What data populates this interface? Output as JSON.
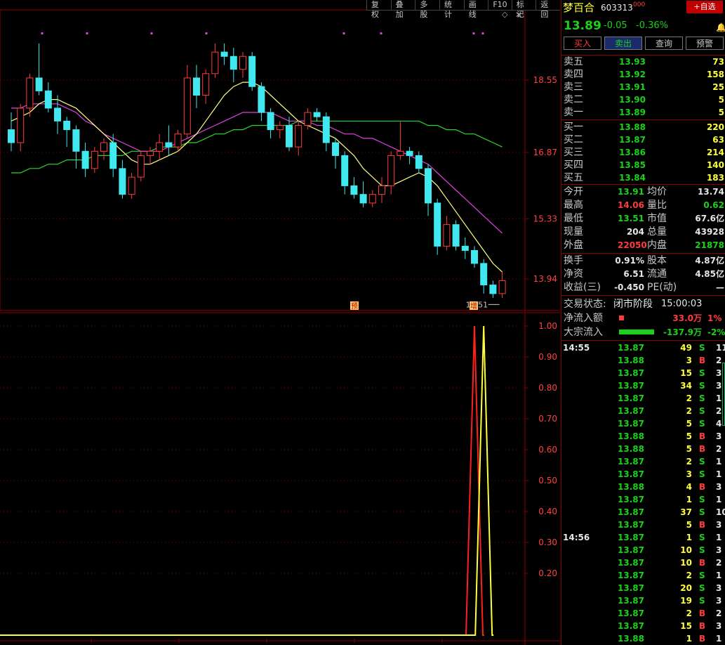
{
  "toolbar": [
    "复权",
    "叠加",
    "多股",
    "统计",
    "画线",
    "F10",
    "标记",
    "返回"
  ],
  "upper_axis": [
    "18.55",
    "16.87",
    "15.33",
    "13.94"
  ],
  "lower_axis": [
    "1.00",
    "0.90",
    "0.80",
    "0.70",
    "0.60",
    "0.50",
    "0.40",
    "0.30",
    "0.20"
  ],
  "annotations": {
    "low_label": "13.51",
    "marker_pre": "预",
    "marker_add": "增"
  },
  "stock": {
    "name": "梦百合",
    "code": "603313",
    "badge": "000",
    "add_btn": "+自选",
    "price": "13.89",
    "change": "-0.05",
    "pct": "-0.36%"
  },
  "trade_buttons": [
    "买入",
    "卖出",
    "查询",
    "预警"
  ],
  "sell_orders": [
    {
      "label": "卖五",
      "price": "13.93",
      "vol": "73"
    },
    {
      "label": "卖四",
      "price": "13.92",
      "vol": "158"
    },
    {
      "label": "卖三",
      "price": "13.91",
      "vol": "25"
    },
    {
      "label": "卖二",
      "price": "13.90",
      "vol": "5"
    },
    {
      "label": "卖一",
      "price": "13.89",
      "vol": "5"
    }
  ],
  "buy_orders": [
    {
      "label": "买一",
      "price": "13.88",
      "vol": "220"
    },
    {
      "label": "买二",
      "price": "13.87",
      "vol": "63"
    },
    {
      "label": "买三",
      "price": "13.86",
      "vol": "214"
    },
    {
      "label": "买四",
      "price": "13.85",
      "vol": "140"
    },
    {
      "label": "买五",
      "price": "13.84",
      "vol": "183"
    }
  ],
  "stats": [
    {
      "l1": "今开",
      "v1": "13.91",
      "l2": "均价",
      "v2": "13.74",
      "c": "g"
    },
    {
      "l1": "最高",
      "v1": "14.06",
      "l2": "量比",
      "v2": "0.62",
      "c": "r"
    },
    {
      "l1": "最低",
      "v1": "13.51",
      "l2": "市值",
      "v2": "67.6亿",
      "c": "g"
    },
    {
      "l1": "现量",
      "v1": "204",
      "l2": "总量",
      "v2": "43928",
      "c": "w"
    },
    {
      "l1": "外盘",
      "v1": "22050",
      "l2": "内盘",
      "v2": "21878",
      "c": "r"
    }
  ],
  "stats2": [
    {
      "l1": "换手",
      "v1": "0.91%",
      "l2": "股本",
      "v2": "4.87亿"
    },
    {
      "l1": "净资",
      "v1": "6.51",
      "l2": "流通",
      "v2": "4.85亿"
    },
    {
      "l1": "收益(三)",
      "v1": "-0.450",
      "l2": "PE(动)",
      "v2": "—"
    }
  ],
  "status": {
    "label": "交易状态:",
    "state": "闭市阶段",
    "time": "15:00:03"
  },
  "flows": [
    {
      "label": "净流入额",
      "value": "33.0万",
      "pct": "1%",
      "bar": "#ff3c3c",
      "barw": 7
    },
    {
      "label": "大宗流入",
      "value": "-137.9万",
      "pct": "-2%",
      "bar": "#19d219",
      "barw": 50
    }
  ],
  "ticks": [
    {
      "time": "14:55",
      "price": "13.87",
      "vol": "49",
      "side": "S",
      "n": "11"
    },
    {
      "time": "",
      "price": "13.88",
      "vol": "3",
      "side": "B",
      "n": "2"
    },
    {
      "time": "",
      "price": "13.87",
      "vol": "15",
      "side": "S",
      "n": "3"
    },
    {
      "time": "",
      "price": "13.87",
      "vol": "34",
      "side": "S",
      "n": "3"
    },
    {
      "time": "",
      "price": "13.87",
      "vol": "2",
      "side": "S",
      "n": "1"
    },
    {
      "time": "",
      "price": "13.87",
      "vol": "2",
      "side": "S",
      "n": "2"
    },
    {
      "time": "",
      "price": "13.87",
      "vol": "5",
      "side": "S",
      "n": "4"
    },
    {
      "time": "",
      "price": "13.88",
      "vol": "5",
      "side": "B",
      "n": "3"
    },
    {
      "time": "",
      "price": "13.88",
      "vol": "5",
      "side": "B",
      "n": "2"
    },
    {
      "time": "",
      "price": "13.87",
      "vol": "2",
      "side": "S",
      "n": "1"
    },
    {
      "time": "",
      "price": "13.87",
      "vol": "3",
      "side": "S",
      "n": "1"
    },
    {
      "time": "",
      "price": "13.88",
      "vol": "4",
      "side": "B",
      "n": "3"
    },
    {
      "time": "",
      "price": "13.87",
      "vol": "1",
      "side": "S",
      "n": "1"
    },
    {
      "time": "",
      "price": "13.87",
      "vol": "37",
      "side": "S",
      "n": "10"
    },
    {
      "time": "",
      "price": "13.87",
      "vol": "5",
      "side": "B",
      "n": "3"
    },
    {
      "time": "14:56",
      "price": "13.87",
      "vol": "1",
      "side": "S",
      "n": "1"
    },
    {
      "time": "",
      "price": "13.87",
      "vol": "10",
      "side": "S",
      "n": "3"
    },
    {
      "time": "",
      "price": "13.87",
      "vol": "10",
      "side": "B",
      "n": "2"
    },
    {
      "time": "",
      "price": "13.87",
      "vol": "2",
      "side": "S",
      "n": "1"
    },
    {
      "time": "",
      "price": "13.87",
      "vol": "20",
      "side": "S",
      "n": "3"
    },
    {
      "time": "",
      "price": "13.87",
      "vol": "19",
      "side": "S",
      "n": "3"
    },
    {
      "time": "",
      "price": "13.87",
      "vol": "2",
      "side": "B",
      "n": "2"
    },
    {
      "time": "",
      "price": "13.87",
      "vol": "15",
      "side": "B",
      "n": "3"
    },
    {
      "time": "",
      "price": "13.88",
      "vol": "1",
      "side": "B",
      "n": "1"
    }
  ],
  "chart_data": {
    "type": "candlestick",
    "price_axis_ticks": [
      18.55,
      16.87,
      15.33,
      13.94
    ],
    "last_low": 13.51,
    "candles": [
      [
        17.4,
        17.8,
        16.9,
        17.1
      ],
      [
        17.1,
        18.0,
        16.9,
        17.9
      ],
      [
        17.9,
        18.7,
        17.7,
        18.6
      ],
      [
        18.6,
        19.4,
        18.2,
        18.3
      ],
      [
        18.3,
        18.5,
        17.8,
        17.9
      ],
      [
        17.9,
        18.2,
        17.3,
        17.6
      ],
      [
        17.6,
        17.7,
        17.0,
        17.4
      ],
      [
        17.4,
        17.5,
        16.5,
        16.9
      ],
      [
        16.9,
        17.1,
        16.3,
        16.5
      ],
      [
        16.5,
        17.0,
        16.4,
        16.9
      ],
      [
        16.9,
        17.2,
        16.7,
        17.1
      ],
      [
        17.1,
        17.3,
        16.3,
        16.5
      ],
      [
        16.5,
        16.7,
        15.8,
        15.9
      ],
      [
        15.9,
        16.4,
        15.8,
        16.3
      ],
      [
        16.3,
        16.9,
        16.2,
        16.8
      ],
      [
        16.8,
        17.0,
        16.6,
        16.9
      ],
      [
        16.9,
        17.3,
        16.7,
        17.1
      ],
      [
        17.1,
        17.5,
        16.8,
        17.0
      ],
      [
        17.0,
        17.4,
        16.9,
        17.3
      ],
      [
        17.3,
        18.9,
        17.2,
        18.6
      ],
      [
        18.6,
        18.9,
        17.9,
        18.2
      ],
      [
        18.2,
        18.8,
        18.0,
        18.7
      ],
      [
        18.7,
        19.4,
        18.6,
        19.2
      ],
      [
        19.2,
        19.4,
        18.9,
        19.1
      ],
      [
        19.1,
        19.3,
        18.5,
        18.8
      ],
      [
        18.8,
        19.2,
        18.6,
        19.1
      ],
      [
        19.1,
        19.2,
        18.3,
        18.4
      ],
      [
        18.4,
        18.5,
        17.6,
        17.8
      ],
      [
        17.8,
        17.9,
        17.2,
        17.4
      ],
      [
        17.4,
        17.6,
        17.2,
        17.5
      ],
      [
        17.5,
        17.7,
        16.9,
        17.0
      ],
      [
        17.0,
        17.6,
        16.8,
        17.5
      ],
      [
        17.5,
        17.9,
        17.4,
        17.8
      ],
      [
        17.8,
        17.9,
        17.6,
        17.7
      ],
      [
        17.7,
        17.8,
        16.9,
        17.1
      ],
      [
        17.1,
        17.2,
        16.5,
        16.8
      ],
      [
        16.8,
        16.9,
        15.9,
        16.1
      ],
      [
        16.1,
        16.3,
        15.8,
        15.9
      ],
      [
        15.9,
        16.2,
        15.6,
        15.7
      ],
      [
        15.7,
        16.0,
        15.6,
        15.9
      ],
      [
        15.9,
        16.3,
        15.7,
        16.1
      ],
      [
        16.1,
        16.9,
        15.9,
        16.8
      ],
      [
        16.8,
        17.6,
        16.7,
        16.9
      ],
      [
        16.9,
        17.0,
        16.6,
        16.8
      ],
      [
        16.8,
        16.9,
        16.4,
        16.5
      ],
      [
        16.5,
        16.6,
        15.4,
        15.7
      ],
      [
        15.7,
        15.8,
        14.5,
        14.7
      ],
      [
        14.7,
        15.4,
        14.6,
        15.2
      ],
      [
        15.2,
        15.3,
        14.6,
        14.7
      ],
      [
        14.7,
        14.9,
        14.4,
        14.6
      ],
      [
        14.6,
        14.7,
        14.2,
        14.3
      ],
      [
        14.3,
        14.4,
        13.6,
        13.8
      ],
      [
        13.8,
        13.9,
        13.5,
        13.6
      ],
      [
        13.6,
        14.1,
        13.5,
        13.9
      ]
    ],
    "ma_yellow": [
      17.6,
      17.7,
      17.8,
      18.0,
      18.1,
      18.1,
      18.0,
      17.9,
      17.7,
      17.5,
      17.3,
      17.1,
      16.9,
      16.7,
      16.6,
      16.6,
      16.7,
      16.8,
      16.9,
      17.1,
      17.3,
      17.6,
      17.9,
      18.2,
      18.4,
      18.5,
      18.5,
      18.4,
      18.2,
      18.0,
      17.8,
      17.6,
      17.5,
      17.4,
      17.3,
      17.2,
      17.0,
      16.8,
      16.5,
      16.3,
      16.1,
      16.1,
      16.2,
      16.3,
      16.4,
      16.3,
      16.1,
      15.8,
      15.5,
      15.2,
      14.9,
      14.6,
      14.3,
      14.1
    ],
    "ma_magenta": [
      17.9,
      17.9,
      18.0,
      18.0,
      18.0,
      18.0,
      17.9,
      17.8,
      17.6,
      17.5,
      17.3,
      17.2,
      17.1,
      17.0,
      16.9,
      16.9,
      16.9,
      17.0,
      17.1,
      17.2,
      17.3,
      17.4,
      17.5,
      17.6,
      17.7,
      17.8,
      17.8,
      17.8,
      17.8,
      17.7,
      17.6,
      17.6,
      17.6,
      17.5,
      17.5,
      17.4,
      17.3,
      17.3,
      17.2,
      17.2,
      17.1,
      17.0,
      16.9,
      16.8,
      16.7,
      16.6,
      16.4,
      16.2,
      16.0,
      15.8,
      15.6,
      15.4,
      15.2,
      15.0
    ],
    "ma_green": [
      16.4,
      16.4,
      16.5,
      16.5,
      16.6,
      16.6,
      16.7,
      16.7,
      16.7,
      16.8,
      16.8,
      16.8,
      16.8,
      16.9,
      16.9,
      16.9,
      17.0,
      17.0,
      17.0,
      17.1,
      17.1,
      17.2,
      17.3,
      17.3,
      17.4,
      17.4,
      17.5,
      17.5,
      17.5,
      17.5,
      17.5,
      17.6,
      17.6,
      17.6,
      17.6,
      17.6,
      17.6,
      17.6,
      17.6,
      17.6,
      17.6,
      17.6,
      17.6,
      17.6,
      17.6,
      17.5,
      17.5,
      17.4,
      17.4,
      17.3,
      17.3,
      17.2,
      17.1,
      17.0
    ],
    "indicator_axis_ticks": [
      1.0,
      0.9,
      0.8,
      0.7,
      0.6,
      0.5,
      0.4,
      0.3,
      0.2
    ],
    "indicator_red_peak_bar": 50,
    "indicator_yellow_peak_bar": 51
  }
}
